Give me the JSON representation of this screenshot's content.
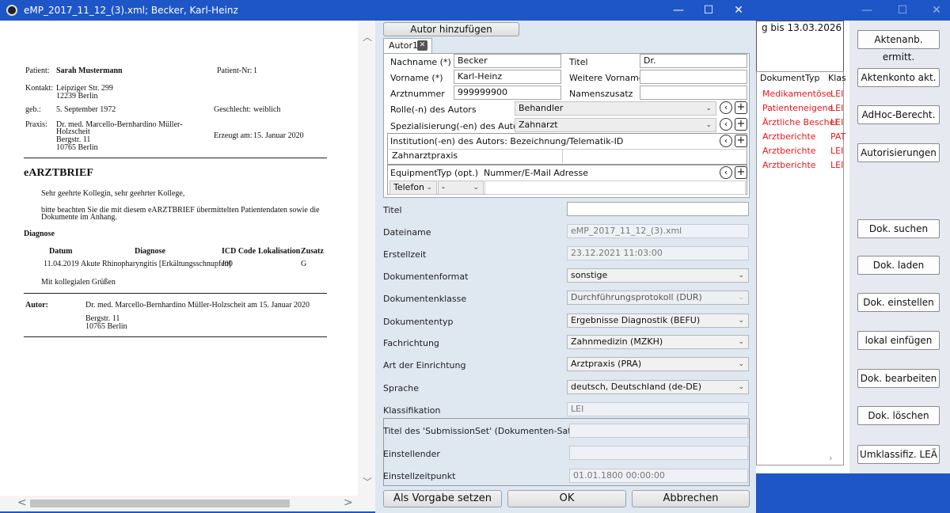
{
  "window": {
    "title": "eMP_2017_11_12_(3).xml; Becker, Karl-Heinz",
    "min": "—",
    "max": "☐",
    "close": "✕"
  },
  "background": {
    "top_label": "g bis 13.03.2026",
    "header_doctype": "DokumentTyp",
    "header_class": "Klas",
    "rows": [
      {
        "type": "Medikamentöse",
        "cls": "LEI"
      },
      {
        "type": "Patienteneigene",
        "cls": "LEI"
      },
      {
        "type": "Ärztliche Beschei",
        "cls": "LEI"
      },
      {
        "type": "Arztberichte",
        "cls": "PAT"
      },
      {
        "type": "Arztberichte",
        "cls": "LEI"
      },
      {
        "type": "Arztberichte",
        "cls": "LEI"
      }
    ],
    "buttons": [
      "Aktenanb. ermitt.",
      "Aktenkonto akt.",
      "AdHoc-Berecht.",
      "Autorisierungen",
      "Dok. suchen",
      "Dok. laden",
      "Dok. einstellen",
      "lokal einfügen",
      "Dok. bearbeiten",
      "Dok. löschen",
      "Umklassifiz. LEÄ"
    ]
  },
  "doc": {
    "patient_label": "Patient:",
    "patient": "Sarah Mustermann",
    "patnr_label": "Patient-Nr:",
    "patnr": "1",
    "kontakt_label": "Kontakt:",
    "kontakt1": "Leipziger Str. 299",
    "kontakt2": "12239 Berlin",
    "geb_label": "geb.:",
    "geb": "5. September 1972",
    "geschlecht_label": "Geschlecht:",
    "geschlecht": "weiblich",
    "praxis_label": "Praxis:",
    "praxis1": "Dr. med. Marcello-Bernhardino Müller-",
    "praxis2": "Holzscheit",
    "praxis3": "Bergstr. 11",
    "praxis4": "10765 Berlin",
    "erzeugt_label": "Erzeugt am:",
    "erzeugt": "15. Januar 2020",
    "heading": "eARZTBRIEF",
    "greeting": "Sehr geehrte Kollegin, sehr geehrter Kollege,",
    "body1": "bitte beachten Sie die mit diesem eARZTBRIEF übermittelten Patientendaten sowie die",
    "body2": "Dokumente im Anhang.",
    "diag_heading": "Diagnose",
    "cols": [
      "Datum",
      "Diagnose",
      "ICD Code",
      "Lokalisation",
      "Zusatz"
    ],
    "row": [
      "11.04.2019",
      "Akute Rhinopharyngitis [Erkältungsschnupfen]",
      "J00",
      "",
      "G"
    ],
    "closing": "Mit kollegialen Grüßen",
    "autor_label": "Autor:",
    "autor1": "Dr. med. Marcello-Bernhardino Müller-Holzscheit am 15. Januar 2020",
    "autor2": "Bergstr. 11",
    "autor3": "10765 Berlin"
  },
  "form": {
    "add_author": "Autor hinzufügen",
    "tab": "Autor1",
    "tab_close": "✕",
    "nachname_label": "Nachname (*)",
    "nachname": "Becker",
    "titel_label": "Titel",
    "titel": "Dr.",
    "vorname_label": "Vorname (*)",
    "vorname": "Karl-Heinz",
    "weitere_label": "Weitere Vornamen",
    "weitere": "",
    "arztnr_label": "Arztnummer",
    "arztnr": "999999900",
    "namenszusatz_label": "Namenszusatz",
    "namenszusatz": "",
    "rolle_label": "Rolle(-n) des Autors",
    "rolle": "Behandler",
    "spez_label": "Spezialisierung(-en) des Autors",
    "spez": "Zahnarzt",
    "inst_label": "Institution(-en) des Autors: Bezeichnung/Telematik-ID",
    "inst": "Zahnarztpraxis",
    "inst_id": "",
    "equip_label": "Equipment",
    "typ_label": "Typ (opt.)",
    "nummer_label": "Nummer/E-Mail Adresse",
    "equip": "Telefon",
    "typ": "-",
    "nummer": "",
    "fields": [
      {
        "label": "Titel",
        "value": "",
        "kind": "ed"
      },
      {
        "label": "Dateiname",
        "value": "eMP_2017_11_12_(3).xml",
        "kind": "ro"
      },
      {
        "label": "Erstellzeit",
        "value": "23.12.2021 11:03:00",
        "kind": "ro"
      },
      {
        "label": "Dokumentenformat",
        "value": "sonstige",
        "kind": "cb"
      },
      {
        "label": "Dokumentenklasse",
        "value": "Durchführungsprotokoll (DUR)",
        "kind": "cbdis"
      },
      {
        "label": "Dokumententyp",
        "value": "Ergebnisse Diagnostik (BEFU)",
        "kind": "cb"
      },
      {
        "label": "Fachrichtung",
        "value": "Zahnmedizin (MZKH)",
        "kind": "cb"
      },
      {
        "label": "Art der Einrichtung",
        "value": "Arztpraxis (PRA)",
        "kind": "cb"
      },
      {
        "label": "Sprache",
        "value": "deutsch, Deutschland (de-DE)",
        "kind": "cb"
      },
      {
        "label": "Klassifikation",
        "value": "LEI",
        "kind": "ro"
      }
    ],
    "sub_title_label": "Titel des 'SubmissionSet' (Dokumenten-Satz)",
    "sub_title": "",
    "einsteller_label": "Einstellender",
    "einsteller": "",
    "zeit_label": "Einstellzeitpunkt",
    "zeit": "01.01.1800 00:00:00",
    "btn_vorgabe": "Als Vorgabe setzen",
    "btn_ok": "OK",
    "btn_cancel": "Abbrechen"
  }
}
